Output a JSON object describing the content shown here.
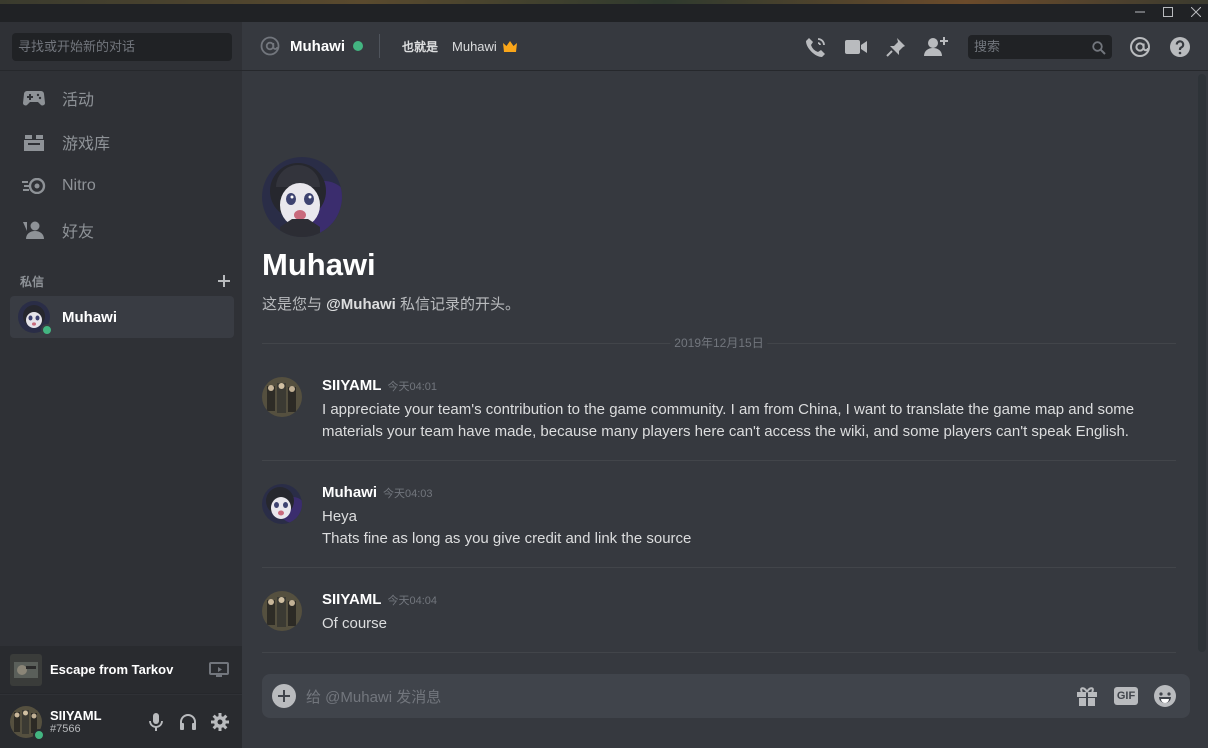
{
  "window": {
    "minimize_icon": "minimize-icon",
    "maximize_icon": "maximize-icon",
    "close_icon": "close-icon"
  },
  "sidebar": {
    "search_placeholder": "寻找或开始新的对话",
    "nav": [
      {
        "label": "活动",
        "icon": "gamepad-icon"
      },
      {
        "label": "游戏库",
        "icon": "library-icon"
      },
      {
        "label": "Nitro",
        "icon": "nitro-icon"
      },
      {
        "label": "好友",
        "icon": "friends-icon"
      }
    ],
    "dm_header": "私信",
    "dm_list": [
      {
        "name": "Muhawi",
        "status": "online"
      }
    ],
    "activity": {
      "game": "Escape from Tarkov"
    },
    "user": {
      "name": "SIIYAML",
      "tag": "#7566"
    }
  },
  "header": {
    "name": "Muhawi",
    "aka_label": "也就是",
    "aka_name": "Muhawi",
    "search_placeholder": "搜索"
  },
  "conversation": {
    "title": "Muhawi",
    "intro_prefix": "这是您与 ",
    "intro_mention": "@Muhawi",
    "intro_suffix": " 私信记录的开头。",
    "date_divider": "2019年12月15日",
    "messages": [
      {
        "author": "SIIYAML",
        "time": "今天04:01",
        "lines": [
          "I appreciate your team's contribution to the game community. I am from China, I want to translate the game map and some materials your team have made, because many players here can't access the wiki, and some players can't speak English."
        ]
      },
      {
        "author": "Muhawi",
        "time": "今天04:03",
        "lines": [
          "Heya",
          "Thats fine as long as you give credit and link the source"
        ]
      },
      {
        "author": "SIIYAML",
        "time": "今天04:04",
        "lines": [
          "Of course"
        ]
      }
    ]
  },
  "composer": {
    "placeholder": "给 @Muhawi 发消息",
    "gif_label": "GIF"
  },
  "colors": {
    "background_primary": "#36393f",
    "background_secondary": "#2f3136",
    "background_tertiary": "#202225",
    "online": "#43b581",
    "text_normal": "#dcddde",
    "text_muted": "#72767d"
  }
}
